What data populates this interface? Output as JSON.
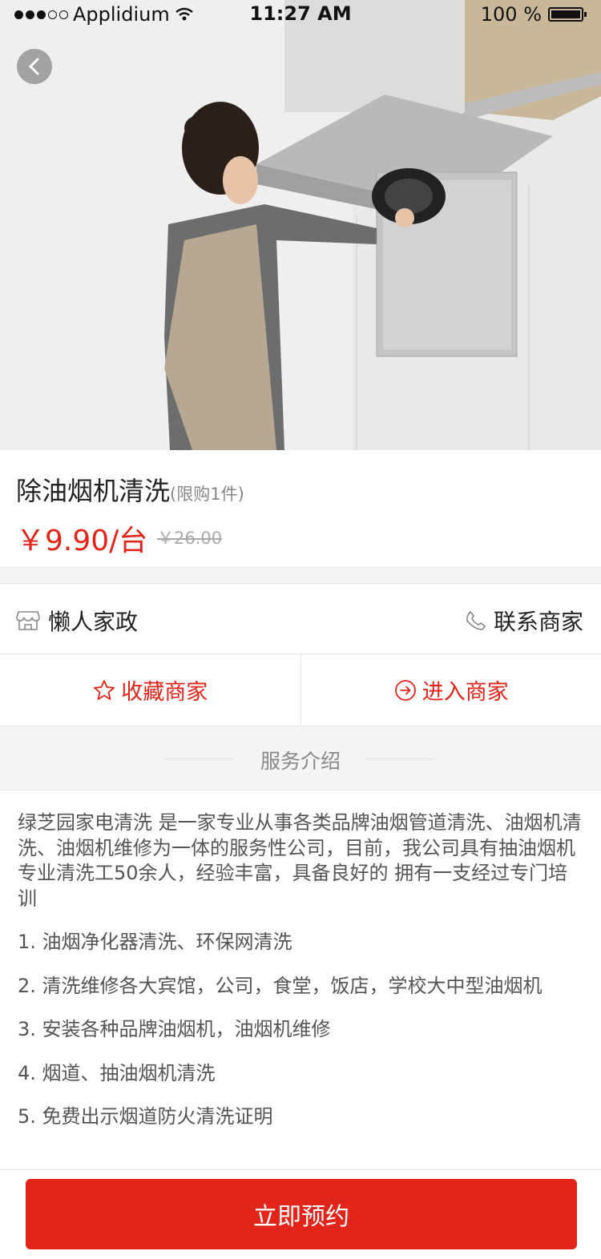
{
  "status_bar": {
    "carrier": "Applidium",
    "time": "11:27 AM",
    "battery": "100 %"
  },
  "hero": {
    "image_desc_icon": "range-hood-cleaning-photo",
    "back_icon": "chevron-left-icon"
  },
  "product": {
    "title": "除油烟机清洗",
    "limit": "(限购1件)",
    "price": "￥9.90/台",
    "original_price": "￥26.00"
  },
  "shop": {
    "name": "懒人家政",
    "contact_label": "联系商家"
  },
  "actions": {
    "favorite_label": "收藏商家",
    "enter_label": "进入商家"
  },
  "service": {
    "heading": "服务介绍",
    "description": "绿芝园家电清洗 是一家专业从事各类品牌油烟管道清洗、油烟机清洗、油烟机维修为一体的服务性公司，目前，我公司具有抽油烟机专业清洗工50余人，经验丰富，具备良好的 拥有一支经过专门培训",
    "items": [
      "1. 油烟净化器清洗、环保网清洗",
      "2. 清洗维修各大宾馆，公司，食堂，饭店，学校大中型油烟机",
      "3. 安装各种品牌油烟机，油烟机维修",
      "4. 烟道、抽油烟机清洗",
      "5. 免费出示烟道防火清洗证明"
    ]
  },
  "cta": {
    "book_label": "立即预约"
  },
  "colors": {
    "accent": "#e1251b",
    "divider": "#e6e6e6",
    "section_bg": "#f4f4f4"
  }
}
